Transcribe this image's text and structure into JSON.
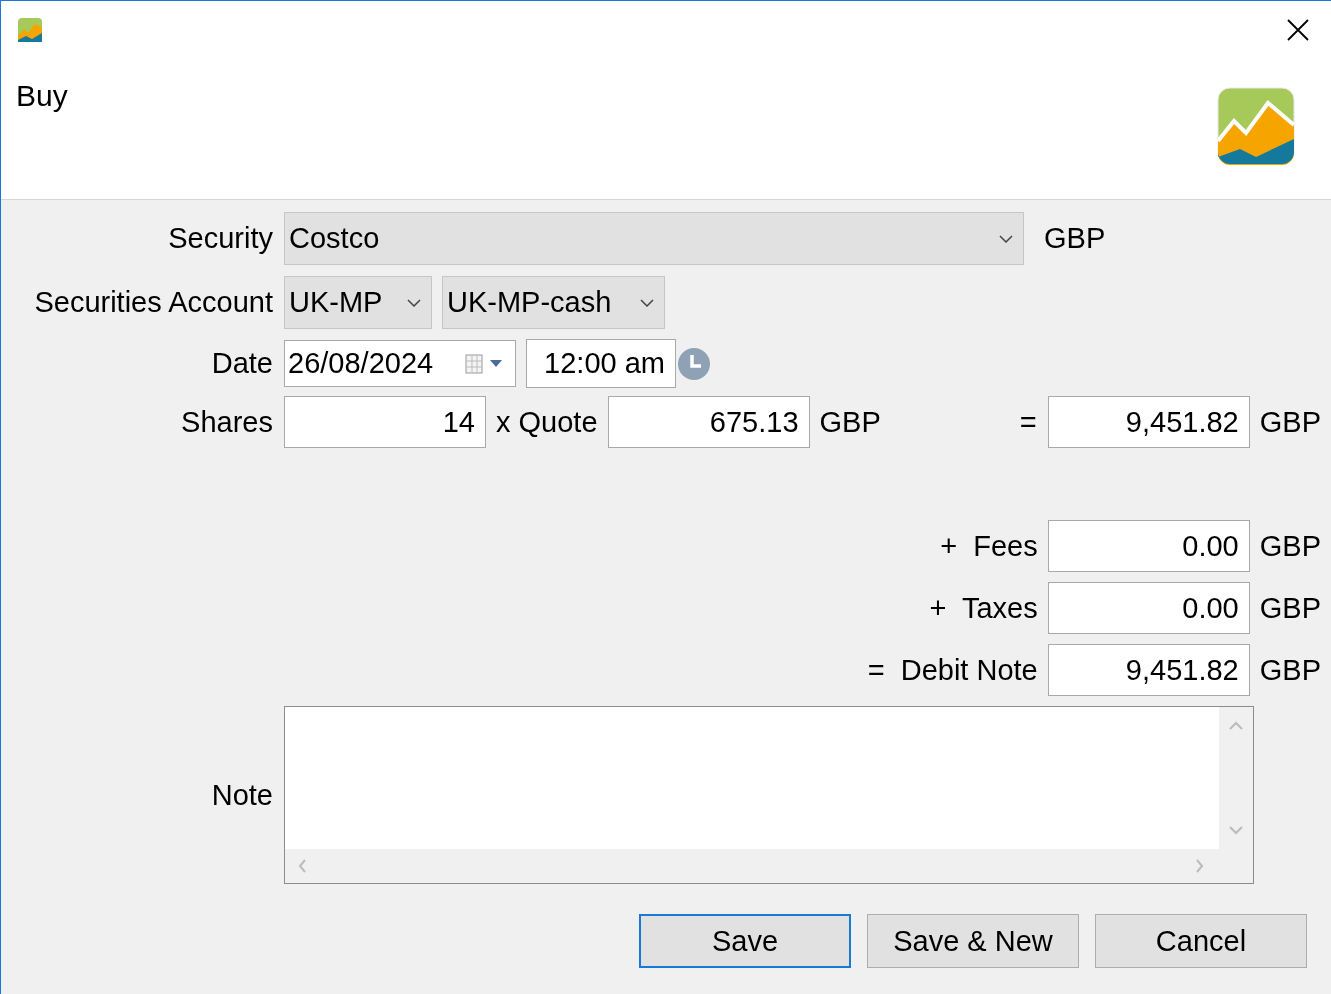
{
  "window": {
    "title": "Buy"
  },
  "security": {
    "label": "Security",
    "value": "Costco",
    "currency": "GBP"
  },
  "account": {
    "label": "Securities Account",
    "securities_account": "UK-MP",
    "cash_account": "UK-MP-cash"
  },
  "date": {
    "label": "Date",
    "date": "26/08/2024",
    "time": "12:00 am"
  },
  "shares": {
    "label": "Shares",
    "value": "14"
  },
  "quote": {
    "label": "x Quote",
    "value": "675.13",
    "currency": "GBP"
  },
  "total": {
    "label": "=",
    "value": "9,451.82",
    "currency": "GBP"
  },
  "amounts": [
    {
      "label": "+  Fees",
      "value": "0.00",
      "currency": "GBP"
    },
    {
      "label": "+  Taxes",
      "value": "0.00",
      "currency": "GBP"
    },
    {
      "label": "=  Debit Note",
      "value": "9,451.82",
      "currency": "GBP"
    }
  ],
  "note": {
    "label": "Note"
  },
  "buttons": [
    {
      "label": "Save",
      "default": true
    },
    {
      "label": "Save & New",
      "default": false
    },
    {
      "label": "Cancel",
      "default": false
    }
  ]
}
